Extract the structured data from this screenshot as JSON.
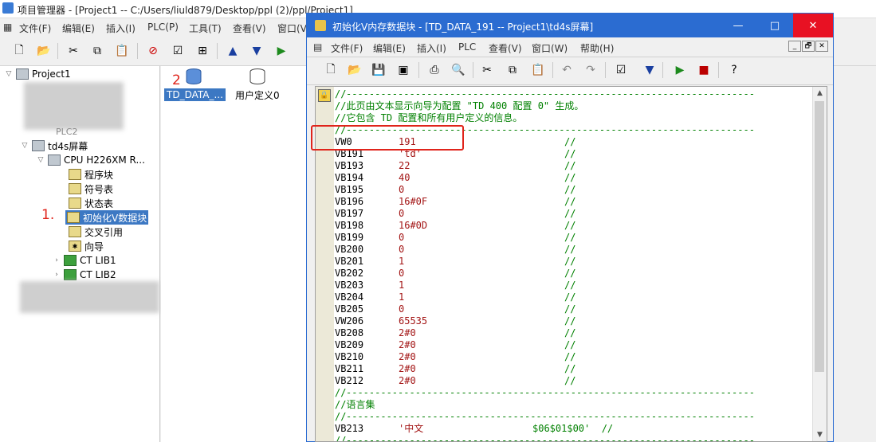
{
  "outer_window": {
    "title": "项目管理器 - [Project1 -- C:/Users/liuld879/Desktop/ppl (2)/ppl/Project1]",
    "menu": [
      "文件(F)",
      "编辑(E)",
      "插入(I)",
      "PLC(P)",
      "工具(T)",
      "查看(V)",
      "窗口(V"
    ]
  },
  "tree": {
    "root": "Project1",
    "hidden_item": "PLC2",
    "device": "td4s屏幕",
    "cpu": "CPU H226XM R...",
    "items": [
      {
        "label": "程序块",
        "icon": "program-block-icon"
      },
      {
        "label": "符号表",
        "icon": "symbol-table-icon"
      },
      {
        "label": "状态表",
        "icon": "status-table-icon"
      },
      {
        "label": "初始化V数据块",
        "icon": "data-block-icon"
      },
      {
        "label": "交叉引用",
        "icon": "cross-reference-icon"
      },
      {
        "label": "向导",
        "icon": "wizard-icon"
      }
    ],
    "libs": [
      "CT LIB1",
      "CT LIB2"
    ]
  },
  "middle_panel": {
    "items": [
      "TD_DATA_...",
      "用户定义0"
    ]
  },
  "annotations": {
    "step1": "1.",
    "step2": "2"
  },
  "inner_window": {
    "title": "初始化V内存数据块 - [TD_DATA_191 -- Project1\\td4s屏幕]",
    "buttons": {
      "minimize": "—",
      "maximize": "□",
      "close": "✕"
    },
    "menu": [
      "文件(F)",
      "编辑(E)",
      "插入(I)",
      "PLC",
      "查看(V)",
      "窗口(W)",
      "帮助(H)"
    ],
    "mdi": {
      "min": "_",
      "restore": "🗗",
      "close": "✕"
    }
  },
  "editor": {
    "lines": [
      {
        "addr": "//",
        "val": "",
        "cmt": "-----------------------------------------------------------------------"
      },
      {
        "addr": "",
        "val": "",
        "cmt": "//此页由文本显示向导为配置 \"TD 400 配置 0\" 生成。"
      },
      {
        "addr": "",
        "val": "",
        "cmt": "//它包含 TD 配置和所有用户定义的信息。"
      },
      {
        "addr": "//",
        "val": "",
        "cmt": "-----------------------------------------------------------------------"
      },
      {
        "addr": "VW0",
        "val": "191",
        "cmt": "//"
      },
      {
        "addr": "VB191",
        "val": "'td'",
        "cmt": "//"
      },
      {
        "addr": "VB193",
        "val": "22",
        "cmt": "//"
      },
      {
        "addr": "VB194",
        "val": "40",
        "cmt": "//"
      },
      {
        "addr": "VB195",
        "val": "0",
        "cmt": "//"
      },
      {
        "addr": "VB196",
        "val": "16#0F",
        "cmt": "//"
      },
      {
        "addr": "VB197",
        "val": "0",
        "cmt": "//"
      },
      {
        "addr": "VB198",
        "val": "16#0D",
        "cmt": "//"
      },
      {
        "addr": "VB199",
        "val": "0",
        "cmt": "//"
      },
      {
        "addr": "VB200",
        "val": "0",
        "cmt": "//"
      },
      {
        "addr": "VB201",
        "val": "1",
        "cmt": "//"
      },
      {
        "addr": "VB202",
        "val": "0",
        "cmt": "//"
      },
      {
        "addr": "VB203",
        "val": "1",
        "cmt": "//"
      },
      {
        "addr": "VB204",
        "val": "1",
        "cmt": "//"
      },
      {
        "addr": "VB205",
        "val": "0",
        "cmt": "//"
      },
      {
        "addr": "VW206",
        "val": "65535",
        "cmt": "//"
      },
      {
        "addr": "VB208",
        "val": "2#0",
        "cmt": "//"
      },
      {
        "addr": "VB209",
        "val": "2#0",
        "cmt": "//"
      },
      {
        "addr": "VB210",
        "val": "2#0",
        "cmt": "//"
      },
      {
        "addr": "VB211",
        "val": "2#0",
        "cmt": "//"
      },
      {
        "addr": "VB212",
        "val": "2#0",
        "cmt": "//"
      },
      {
        "addr": "//",
        "val": "",
        "cmt": "-----------------------------------------------------------------------"
      },
      {
        "addr": "",
        "val": "",
        "cmt": "//语言集"
      },
      {
        "addr": "//",
        "val": "",
        "cmt": "-----------------------------------------------------------------------"
      },
      {
        "addr": "VB213",
        "val": "'中文",
        "cmt": "$06$01$00'  //"
      },
      {
        "addr": "//",
        "val": "",
        "cmt": "-----------------------------------------------------------------------"
      }
    ]
  },
  "colors": {
    "title_blue": "#2b6cd1",
    "highlight_red": "#e0241b",
    "comment_green": "#008000",
    "value_red": "#a31515"
  }
}
